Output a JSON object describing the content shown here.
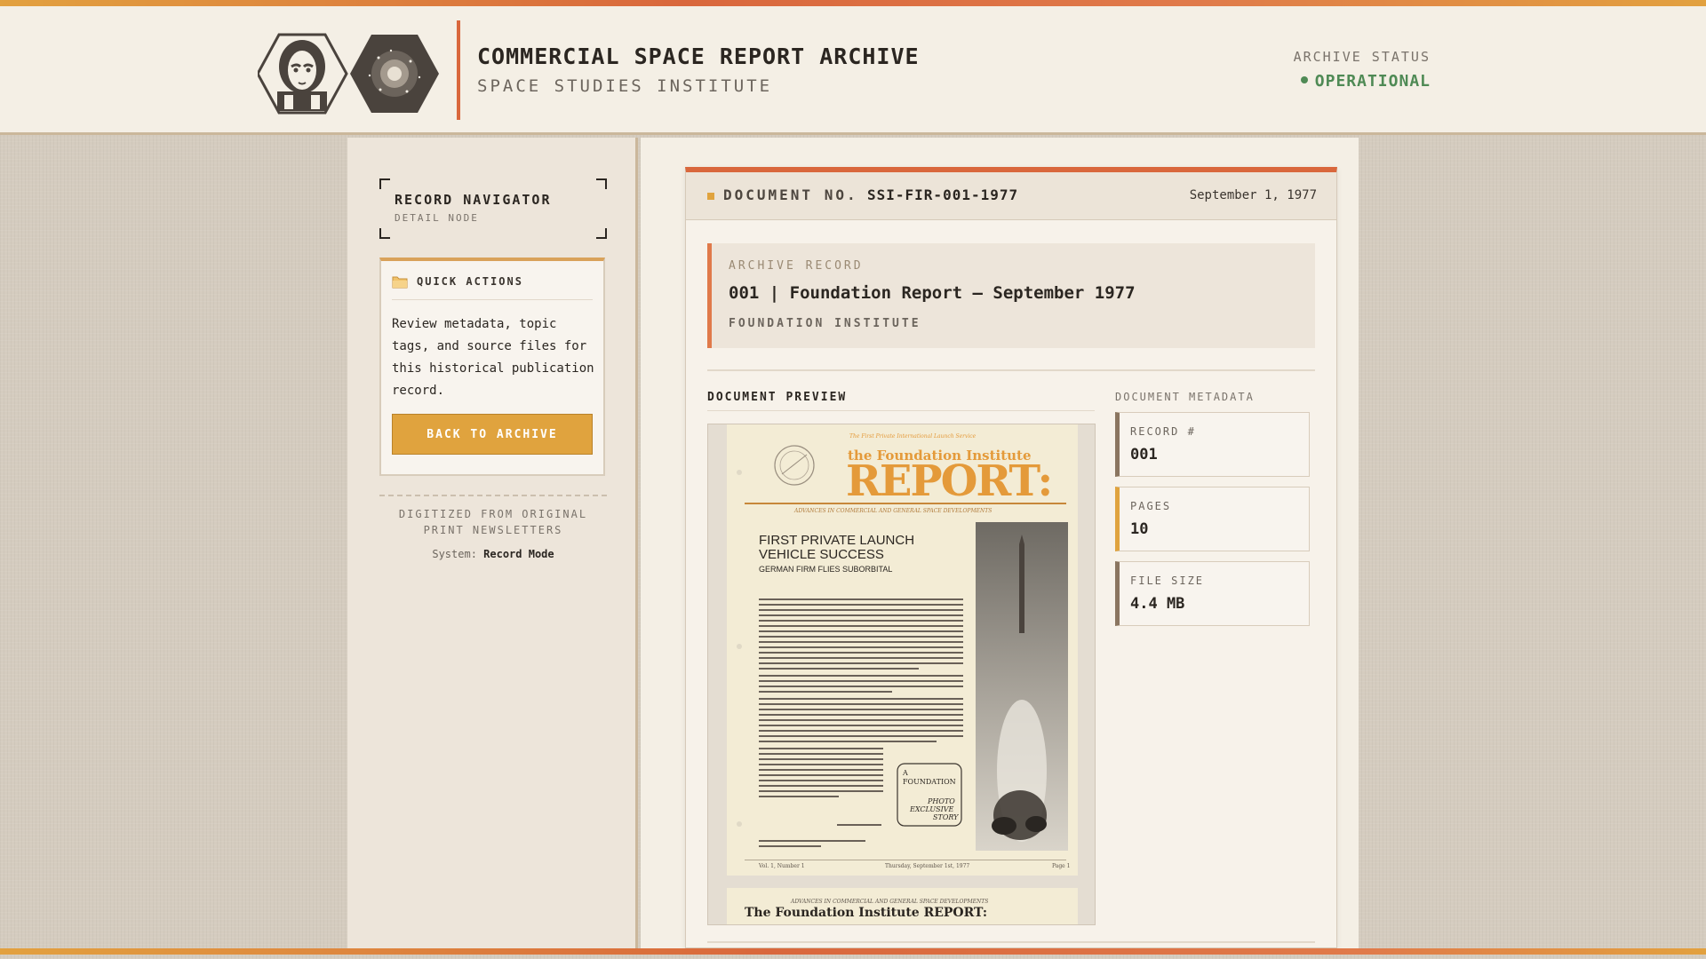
{
  "header": {
    "title": "COMMERCIAL SPACE REPORT ARCHIVE",
    "subtitle": "SPACE STUDIES INSTITUTE",
    "status_label": "ARCHIVE STATUS",
    "status_value": "OPERATIONAL",
    "status_color": "#4f8a55"
  },
  "sidebar": {
    "nav_title": "RECORD NAVIGATOR",
    "nav_subtitle": "DETAIL NODE",
    "quick_actions": {
      "title": "QUICK ACTIONS",
      "icon": "folder-icon",
      "text": "Review metadata, topic tags, and source files for this historical publication record.",
      "button_label": "BACK TO ARCHIVE"
    },
    "note": "DIGITIZED FROM ORIGINAL PRINT NEWSLETTERS",
    "system_label": "System:",
    "system_value": "Record Mode"
  },
  "document": {
    "number_label": "DOCUMENT NO.",
    "number_value": "SSI-FIR-001-1977",
    "date": "September 1, 1977",
    "record_label": "ARCHIVE RECORD",
    "record_title": "001 | Foundation Report — September 1977",
    "record_org": "FOUNDATION INSTITUTE",
    "preview_label": "DOCUMENT PREVIEW",
    "metadata_label": "DOCUMENT METADATA",
    "metadata": [
      {
        "key": "RECORD #",
        "value": "001"
      },
      {
        "key": "PAGES",
        "value": "10"
      },
      {
        "key": "FILE SIZE",
        "value": "4.4 MB"
      }
    ]
  },
  "newsletter": {
    "masthead_top": "The First Private International Launch Service",
    "masthead_org": "the Foundation Institute",
    "masthead_title": "REPORT:",
    "masthead_tagline": "ADVANCES IN COMMERCIAL AND GENERAL SPACE DEVELOPMENTS",
    "headline_1": "FIRST PRIVATE LAUNCH",
    "headline_2": "VEHICLE SUCCESS",
    "subhead": "GERMAN FIRM FLIES SUBORBITAL",
    "badge_1": "A",
    "badge_2": "FOUNDATION",
    "badge_3": "PHOTO",
    "badge_4": "EXCLUSIVE",
    "badge_5": "STORY",
    "footer_left": "Vol. 1, Number 1",
    "footer_mid": "Thursday, September 1st, 1977",
    "footer_right": "Page 1",
    "page2_tagline": "ADVANCES IN COMMERCIAL AND GENERAL SPACE DEVELOPMENTS",
    "page2_title": "The Foundation Institute REPORT:"
  },
  "colors": {
    "accent_orange": "#d9673c",
    "accent_gold": "#e0a33e",
    "background": "#f4efe5"
  }
}
